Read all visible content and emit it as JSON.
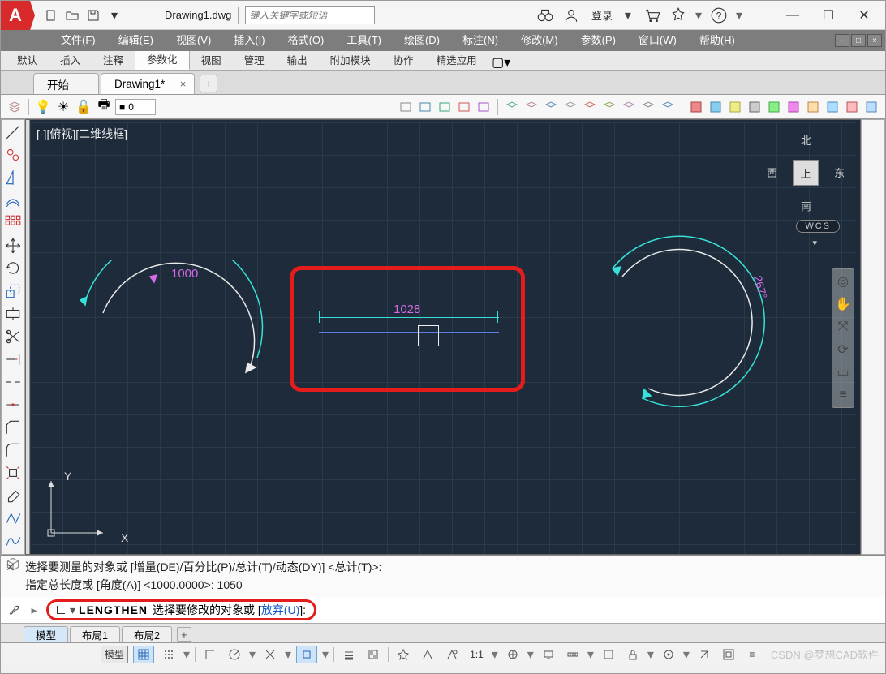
{
  "titlebar": {
    "filename": "Drawing1.dwg",
    "search_placeholder": "键入关键字或短语",
    "login": "登录"
  },
  "menu": [
    "文件(F)",
    "编辑(E)",
    "视图(V)",
    "插入(I)",
    "格式(O)",
    "工具(T)",
    "绘图(D)",
    "标注(N)",
    "修改(M)",
    "参数(P)",
    "窗口(W)",
    "帮助(H)"
  ],
  "ribbon_tabs": [
    "默认",
    "插入",
    "注释",
    "参数化",
    "视图",
    "管理",
    "输出",
    "附加模块",
    "协作",
    "精选应用"
  ],
  "ribbon_active_index": 3,
  "doc_tabs": {
    "items": [
      {
        "label": "开始",
        "closable": false
      },
      {
        "label": "Drawing1*",
        "closable": true
      }
    ],
    "active_index": 1
  },
  "layer_current": "0",
  "canvas": {
    "view_label": "[-][俯视][二维线框]",
    "viewcube": {
      "face": "上",
      "n": "北",
      "s": "南",
      "e": "东",
      "w": "西"
    },
    "wcs": "WCS",
    "left_arc_radius_label": "1000",
    "center_dim_label": "1028",
    "right_arc_angle_label": "267°",
    "ucs_x": "X",
    "ucs_y": "Y"
  },
  "command": {
    "history": [
      "选择要测量的对象或 [增量(DE)/百分比(P)/总计(T)/动态(DY)] <总计(T)>:",
      "指定总长度或 [角度(A)] <1000.0000>: 1050"
    ],
    "active_cmd": "LENGTHEN",
    "prompt_prefix": "选择要修改的对象或 [",
    "prompt_option": "放弃(U)",
    "prompt_suffix": "]:"
  },
  "layout_tabs": [
    "模型",
    "布局1",
    "布局2"
  ],
  "layout_active_index": 0,
  "status": {
    "model": "模型",
    "scale": "1:1",
    "watermark": "CSDN @梦想CAD软件"
  }
}
